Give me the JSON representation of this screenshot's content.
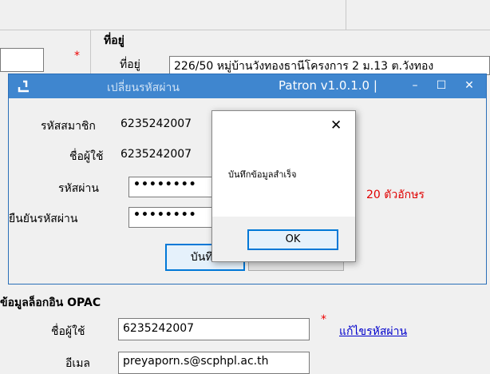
{
  "background": {
    "address_section": "ที่อยู่",
    "address_label": "ที่อยู่",
    "address_value": "226/50 หมู่บ้านวังทองธานีโครงการ 2 ม.13 ต.วังทอง",
    "required_mark": "*",
    "opac_section": "ข้อมูลล็อกอิน OPAC",
    "username_label": "ชื่อผู้ใช้",
    "username_value": "6235242007",
    "email_label": "อีเมล",
    "email_value": "preyaporn.s@scphpl.ac.th",
    "change_password_link": "แก้ไขรหัสผ่าน"
  },
  "pw_window": {
    "title": "เปลี่ยนรหัสผ่าน",
    "app_title": "Patron v1.0.1.0 |",
    "minimize": "–",
    "maximize": "☐",
    "close": "✕",
    "member_id_label": "รหัสสมาชิก",
    "member_id_value": "6235242007",
    "username_label": "ชื่อผู้ใช้",
    "username_value": "6235242007",
    "password_label": "รหัสผ่าน",
    "password_value": "••••••••",
    "confirm_label": "ยืนยันรหัสผ่าน",
    "confirm_value": "••••••••",
    "hint": "20 ตัวอักษร",
    "save_button": "บันทึก"
  },
  "message_box": {
    "close": "✕",
    "message": "บันทึกข้อมูลสำเร็จ",
    "ok_button": "OK"
  }
}
